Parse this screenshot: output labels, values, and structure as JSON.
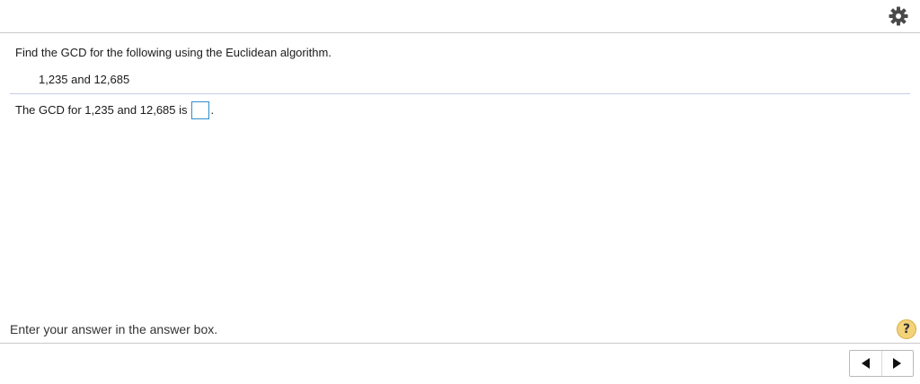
{
  "header": {
    "settings_icon": "gear-icon"
  },
  "question": {
    "prompt": "Find the GCD for the following using the Euclidean algorithm.",
    "numbers": "1,235 and 12,685",
    "answer_prefix": "The GCD for 1,235 and 12,685 is",
    "answer_value": "",
    "answer_suffix": "."
  },
  "footer": {
    "status": "Enter your answer in the answer box.",
    "help_label": "?",
    "prev_icon": "left-triangle-icon",
    "next_icon": "right-triangle-icon"
  },
  "colors": {
    "answer_box_border": "#2f8ec8",
    "help_badge": "#f3d37a",
    "divider": "#c8cde4"
  }
}
